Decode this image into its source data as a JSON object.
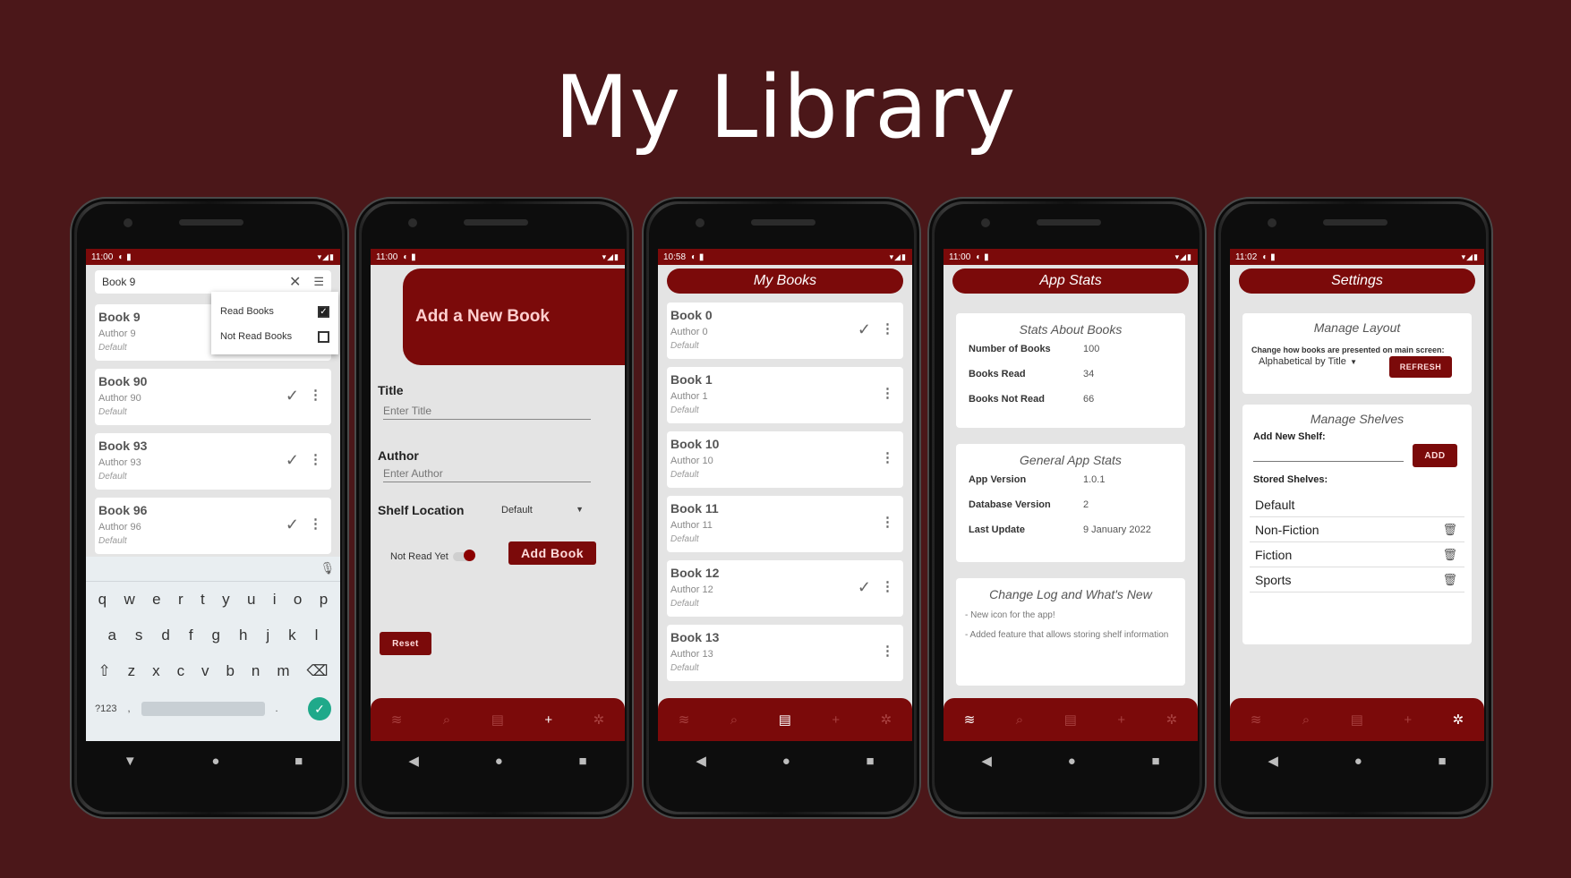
{
  "page": {
    "title": "My Library"
  },
  "colors": {
    "background": "#4b1719",
    "accent": "#7b0a0a",
    "screen": "#e4e4e4"
  },
  "status_icons": {
    "signal": "▾◢▮"
  },
  "phone1": {
    "time": "11:00",
    "search_value": "Book 9",
    "filter": {
      "read_label": "Read Books",
      "read_checked": true,
      "not_read_label": "Not Read Books",
      "not_read_checked": false
    },
    "books": [
      {
        "title": "Book 9",
        "author": "Author 9",
        "shelf": "Default",
        "read": false
      },
      {
        "title": "Book 90",
        "author": "Author 90",
        "shelf": "Default",
        "read": true
      },
      {
        "title": "Book 93",
        "author": "Author 93",
        "shelf": "Default",
        "read": true
      },
      {
        "title": "Book 96",
        "author": "Author 96",
        "shelf": "Default",
        "read": true
      }
    ],
    "keyboard": {
      "row1": [
        "q",
        "w",
        "e",
        "r",
        "t",
        "y",
        "u",
        "i",
        "o",
        "p"
      ],
      "row2": [
        "a",
        "s",
        "d",
        "f",
        "g",
        "h",
        "j",
        "k",
        "l"
      ],
      "row3": [
        "z",
        "x",
        "c",
        "v",
        "b",
        "n",
        "m"
      ],
      "symbols_label": "?123",
      "comma": ",",
      "period": "."
    }
  },
  "phone2": {
    "time": "11:00",
    "header": "Add a New Book",
    "title_label": "Title",
    "title_placeholder": "Enter Title",
    "author_label": "Author",
    "author_placeholder": "Enter Author",
    "shelf_label": "Shelf Location",
    "shelf_value": "Default",
    "toggle_label": "Not Read Yet",
    "add_button": "Add Book",
    "reset_button": "Reset"
  },
  "phone3": {
    "time": "10:58",
    "header": "My Books",
    "books": [
      {
        "title": "Book 0",
        "author": "Author 0",
        "shelf": "Default",
        "read": true
      },
      {
        "title": "Book 1",
        "author": "Author 1",
        "shelf": "Default",
        "read": false
      },
      {
        "title": "Book 10",
        "author": "Author 10",
        "shelf": "Default",
        "read": false
      },
      {
        "title": "Book 11",
        "author": "Author 11",
        "shelf": "Default",
        "read": false
      },
      {
        "title": "Book 12",
        "author": "Author 12",
        "shelf": "Default",
        "read": true
      },
      {
        "title": "Book 13",
        "author": "Author 13",
        "shelf": "Default",
        "read": false
      }
    ]
  },
  "phone4": {
    "time": "11:00",
    "header": "App Stats",
    "books_card": {
      "title": "Stats About Books",
      "rows": [
        {
          "k": "Number of Books",
          "v": "100"
        },
        {
          "k": "Books Read",
          "v": "34"
        },
        {
          "k": "Books Not Read",
          "v": "66"
        }
      ]
    },
    "app_card": {
      "title": "General App Stats",
      "rows": [
        {
          "k": "App Version",
          "v": "1.0.1"
        },
        {
          "k": "Database Version",
          "v": "2"
        },
        {
          "k": "Last Update",
          "v": "9 January 2022"
        }
      ]
    },
    "log_card": {
      "title": "Change Log and What's New",
      "line1": "- New icon for the app!",
      "line2": "- Added feature that allows storing shelf information"
    }
  },
  "phone5": {
    "time": "11:02",
    "header": "Settings",
    "layout_card": {
      "title": "Manage Layout",
      "hint": "Change how books are presented on main screen:",
      "sort_value": "Alphabetical by Title",
      "refresh_button": "REFRESH"
    },
    "shelves_card": {
      "title": "Manage Shelves",
      "add_label": "Add New Shelf:",
      "add_button": "ADD",
      "stored_label": "Stored Shelves:",
      "shelves": [
        {
          "name": "Default",
          "deletable": false
        },
        {
          "name": "Non-Fiction",
          "deletable": true
        },
        {
          "name": "Fiction",
          "deletable": true
        },
        {
          "name": "Sports",
          "deletable": true
        }
      ]
    }
  },
  "nav_icons": [
    "list-icon",
    "search-icon",
    "library-icon",
    "add-icon",
    "settings-icon"
  ]
}
